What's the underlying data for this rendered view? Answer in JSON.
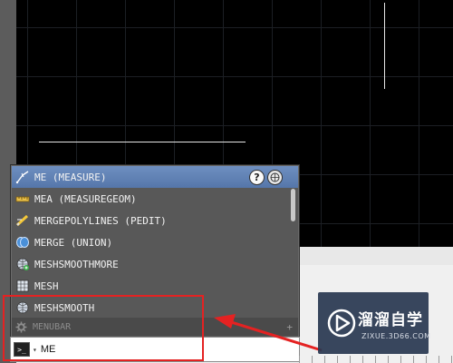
{
  "autocomplete": {
    "items": [
      {
        "label": "ME (MEASURE)",
        "icon": "measure-icon",
        "selected": true
      },
      {
        "label": "MEA (MEASUREGEOM)",
        "icon": "ruler-icon",
        "selected": false
      },
      {
        "label": "MERGEPOLYLINES (PEDIT)",
        "icon": "pedit-icon",
        "selected": false
      },
      {
        "label": "MERGE (UNION)",
        "icon": "union-icon",
        "selected": false
      },
      {
        "label": "MESHSMOOTHMORE",
        "icon": "mesh-smooth-more-icon",
        "selected": false
      },
      {
        "label": "MESH",
        "icon": "mesh-icon",
        "selected": false
      },
      {
        "label": "MESHSMOOTH",
        "icon": "mesh-smooth-icon",
        "selected": false
      }
    ],
    "help_symbol": "?",
    "menubar_label": "MENUBAR",
    "menubar_plus": "+"
  },
  "command_line": {
    "value": "ME",
    "prompt_symbol": ">_"
  },
  "watermark": {
    "title": "溜溜自学",
    "url": "ZIXUE.3D66.COM"
  },
  "colors": {
    "selected_item": "#6080b4",
    "highlight_box": "#e42222",
    "arrow": "#e42222",
    "canvas": "#000000"
  }
}
